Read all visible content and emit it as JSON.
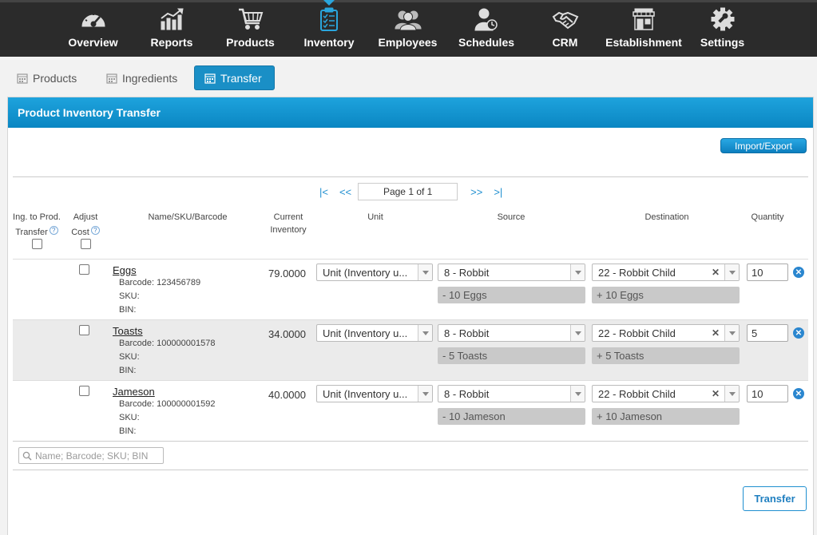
{
  "nav": {
    "items": [
      {
        "label": "Overview",
        "icon": "speedometer-icon"
      },
      {
        "label": "Reports",
        "icon": "chart-icon"
      },
      {
        "label": "Products",
        "icon": "cart-icon"
      },
      {
        "label": "Inventory",
        "icon": "clipboard-icon",
        "active": true
      },
      {
        "label": "Employees",
        "icon": "people-icon"
      },
      {
        "label": "Schedules",
        "icon": "person-clock-icon"
      },
      {
        "label": "CRM",
        "icon": "handshake-icon"
      },
      {
        "label": "Establishment",
        "icon": "storefront-icon"
      },
      {
        "label": "Settings",
        "icon": "gear-icon"
      }
    ]
  },
  "subtabs": [
    {
      "label": "Products"
    },
    {
      "label": "Ingredients"
    },
    {
      "label": "Transfer",
      "active": true
    }
  ],
  "panel": {
    "title": "Product Inventory Transfer",
    "import_export": "Import/Export",
    "pager": {
      "first": "|<",
      "prev": "<<",
      "page": "Page 1 of 1",
      "next": ">>",
      "last": ">|"
    },
    "columns": {
      "ing_to_prod": "Ing. to Prod.",
      "transfer": "Transfer",
      "adjust": "Adjust",
      "cost": "Cost",
      "name": "Name/SKU/Barcode",
      "current": "Current",
      "inventory": "Inventory",
      "unit": "Unit",
      "source": "Source",
      "destination": "Destination",
      "quantity": "Quantity",
      "help": "?"
    },
    "rows": [
      {
        "name": "Eggs",
        "barcode": "Barcode: 123456789",
        "sku": "SKU:",
        "bin": "BIN:",
        "current": "79.0000",
        "unit": "Unit (Inventory u...",
        "source": "8 - Robbit",
        "destination": "22 - Robbit Child",
        "source_delta": "- 10 Eggs",
        "dest_delta": "+ 10 Eggs",
        "quantity": "10"
      },
      {
        "name": "Toasts",
        "barcode": "Barcode: 100000001578",
        "sku": "SKU:",
        "bin": "BIN:",
        "current": "34.0000",
        "unit": "Unit (Inventory u...",
        "source": "8 - Robbit",
        "destination": "22 - Robbit Child",
        "source_delta": "- 5 Toasts",
        "dest_delta": "+ 5 Toasts",
        "quantity": "5"
      },
      {
        "name": "Jameson",
        "barcode": "Barcode: 100000001592",
        "sku": "SKU:",
        "bin": "BIN:",
        "current": "40.0000",
        "unit": "Unit (Inventory u...",
        "source": "8 - Robbit",
        "destination": "22 - Robbit Child",
        "source_delta": "- 10 Jameson",
        "dest_delta": "+ 10 Jameson",
        "quantity": "10"
      }
    ],
    "search_placeholder": "Name; Barcode; SKU; BIN",
    "transfer_button": "Transfer"
  },
  "colors": {
    "accent": "#1a8fc6",
    "nav_bg": "#2b2b2b",
    "active_icon": "#2aa6dd"
  }
}
